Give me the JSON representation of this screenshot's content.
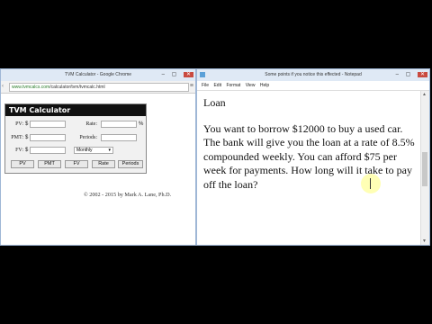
{
  "chrome": {
    "title": "TVM Calculator - Google Chrome",
    "url_host": "www.tvmcalcs.com",
    "url_path": "/calculator/tvm/tvmcalc.html"
  },
  "calculator": {
    "title": "TVM Calculator",
    "pv_label": "PV:",
    "pmt_label": "PMT:",
    "fv_label": "FV:",
    "currency": "$",
    "rate_label": "Rate:",
    "percent": "%",
    "periods_label": "Periods:",
    "frequency": "Monthly",
    "buttons": [
      "PV",
      "PMT",
      "FV",
      "Rate",
      "Periods"
    ]
  },
  "copyright": "© 2002 - 2015 by Mark A. Lane, Ph.D.",
  "notepad": {
    "title": "Some points if you notice this effected - Notepad",
    "menu": [
      "File",
      "Edit",
      "Format",
      "View",
      "Help"
    ],
    "heading": "Loan",
    "text": "You want to borrow $12000 to buy a used car. The bank will give you the loan at a rate of 8.5% compounded weekly. You can afford $75 per week for payments. How long will it take to pay off the loan?"
  }
}
